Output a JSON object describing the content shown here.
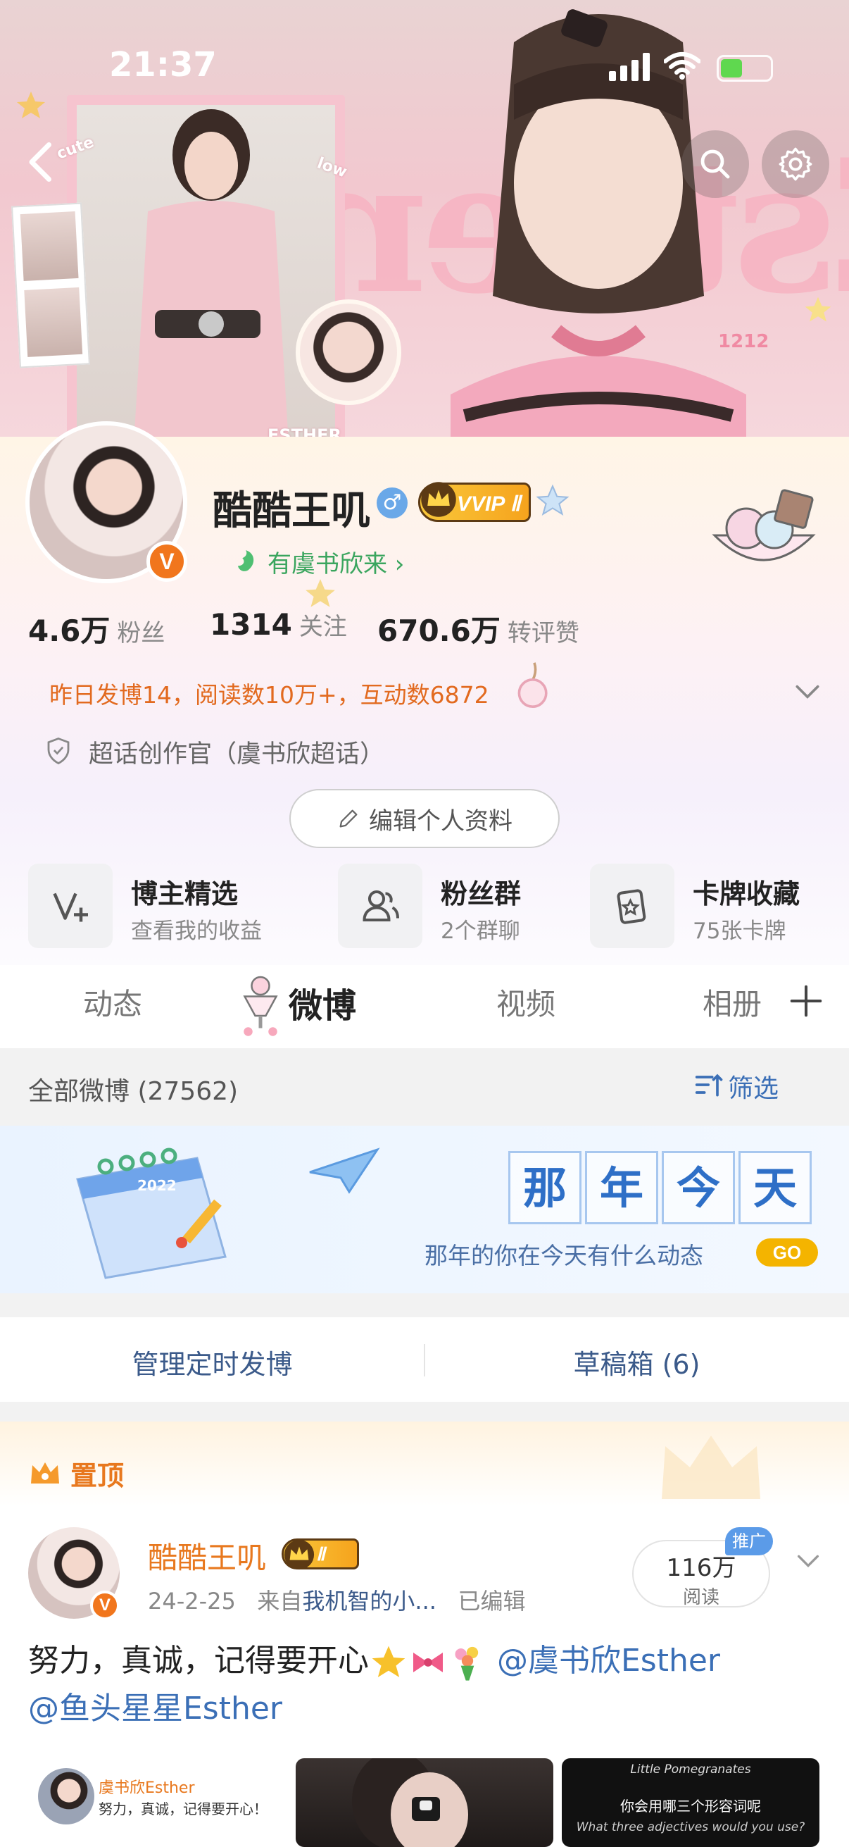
{
  "status_bar": {
    "time": "21:37"
  },
  "banner": {
    "decor_text": "Esther",
    "sticker_cute": "cute",
    "sticker_low": "low",
    "sticker_esther": "ESTHER",
    "sticker_1212": "1212"
  },
  "profile": {
    "username": "酷酷王叽",
    "vip_label": "VVIP Ⅱ",
    "avatar_badge": "V",
    "fan_tag": "有虞书欣来 ›",
    "stats": [
      {
        "num": "4.6万",
        "label": "粉丝"
      },
      {
        "num": "1314",
        "label": "关注"
      },
      {
        "num": "670.6万",
        "label": "转评赞"
      }
    ],
    "summary": "昨日发博14，阅读数10万+，互动数6872",
    "supertopic": "超话创作官（虞书欣超话）",
    "edit_button": "编辑个人资料"
  },
  "quick_cards": [
    {
      "title": "博主精选",
      "sub": "查看我的收益",
      "icon": "v-plus-icon"
    },
    {
      "title": "粉丝群",
      "sub": "2个群聊",
      "icon": "group-icon"
    },
    {
      "title": "卡牌收藏",
      "sub": "75张卡牌",
      "icon": "card-icon"
    }
  ],
  "tabs": [
    {
      "label": "动态",
      "active": false
    },
    {
      "label": "微博",
      "active": true
    },
    {
      "label": "视频",
      "active": false
    },
    {
      "label": "相册",
      "active": false
    }
  ],
  "filter": {
    "count_label": "全部微博 (27562)",
    "filter_label": "筛选"
  },
  "memory": {
    "title_chars": [
      "那",
      "年",
      "今",
      "天"
    ],
    "subtitle": "那年的你在今天有什么动态",
    "go_label": "GO",
    "calendar_year": "2022"
  },
  "manage": {
    "left": "管理定时发博",
    "right": "草稿箱 (6)"
  },
  "pinned_post": {
    "pin_label": "置顶",
    "author": "酷酷王叽",
    "badge": "Ⅱ",
    "date": "24-2-25",
    "source_prefix": "来自",
    "source": "我机智的小...",
    "edited": "已编辑",
    "reads_num": "116万",
    "reads_label": "阅读",
    "promo_label": "推广",
    "text_main": "努力，真诚，记得要开心",
    "mention_1": "@虞书欣Esther",
    "mention_2": "@鱼头星星Esther",
    "thumb_1_name": "虞书欣Esther",
    "thumb_1_text": "努力，真诚，记得要开心！",
    "thumb_3_top": "Little Pomegranates",
    "thumb_3_mid": "你会用哪三个形容词呢",
    "thumb_3_bot": "What three adjectives would you use?"
  },
  "colors": {
    "accent_orange": "#e8781e",
    "link_blue": "#3b6fb6",
    "vip_gold": "#f6a31d"
  }
}
